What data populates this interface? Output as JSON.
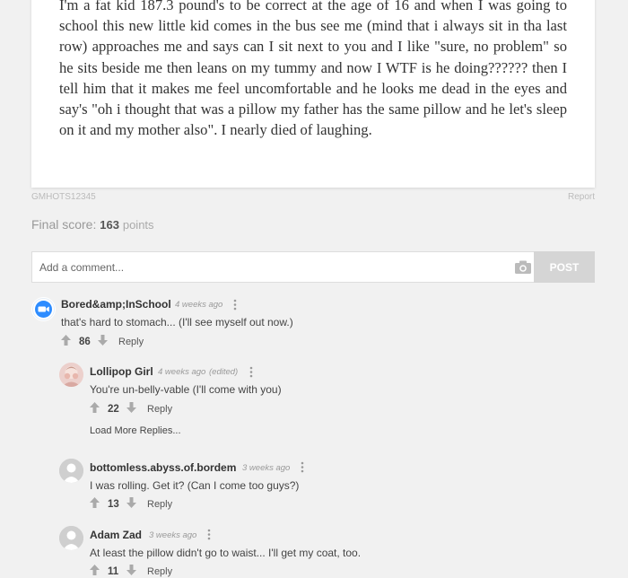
{
  "post": {
    "story": "I'm a fat kid 187.3 pound's to be correct at the age of 16 and when I was going to school this new little kid comes in the bus see me (mind that i always sit in tha last row) approaches me and says can I sit next to you and I like \"sure, no problem\" so he sits beside me then leans on my tummy and now I WTF is he doing?????? then I tell him that it makes me feel uncomfortable and he looks me dead in the eyes and say's \"oh i thought that was a pillow my father has the same pillow and he let's sleep on it and my mother also\". I nearly died of laughing.",
    "id": "GMHOTS12345",
    "report_label": "Report"
  },
  "score": {
    "label": "Final score:",
    "value": "163",
    "unit": "points"
  },
  "comment_form": {
    "placeholder": "Add a comment...",
    "post_label": "POST"
  },
  "comments": [
    {
      "author": "Bored&amp;InSchool",
      "time": "4 weeks ago",
      "edited": "",
      "text": "that's hard to stomach... (I'll see myself out now.)",
      "votes": "86",
      "reply": "Reply"
    },
    {
      "author": "Lollipop Girl",
      "time": "4 weeks ago",
      "edited": "(edited)",
      "text": "You're un-belly-vable (I'll come with you)",
      "votes": "22",
      "reply": "Reply"
    },
    {
      "author": "bottomless.abyss.of.bordem",
      "time": "3 weeks ago",
      "edited": "",
      "text": "I was rolling. Get it? (Can I come too guys?)",
      "votes": "13",
      "reply": "Reply"
    },
    {
      "author": "Adam Zad",
      "time": "3 weeks ago",
      "edited": "",
      "text": "At least the pillow didn't go to waist... I'll get my coat, too.",
      "votes": "11",
      "reply": "Reply"
    }
  ],
  "load_more_label": "Load More Replies...",
  "colors": {
    "arrow": "#aaaaaa",
    "post_button": "#d5d5d5",
    "background": "#f1f1f1"
  }
}
